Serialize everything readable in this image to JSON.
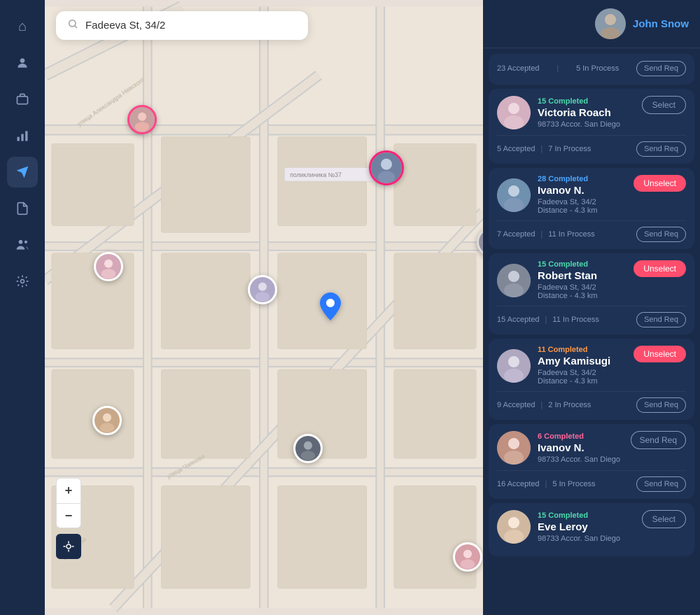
{
  "sidebar": {
    "items": [
      {
        "id": "home",
        "icon": "⌂",
        "label": "Home",
        "active": false
      },
      {
        "id": "person",
        "icon": "👤",
        "label": "Profile",
        "active": false
      },
      {
        "id": "briefcase",
        "icon": "💼",
        "label": "Work",
        "active": false
      },
      {
        "id": "chart",
        "icon": "📊",
        "label": "Analytics",
        "active": false
      },
      {
        "id": "send",
        "icon": "✈",
        "label": "Send",
        "active": true
      },
      {
        "id": "doc",
        "icon": "📄",
        "label": "Documents",
        "active": false
      },
      {
        "id": "group",
        "icon": "👥",
        "label": "Group",
        "active": false
      },
      {
        "id": "settings",
        "icon": "⚙",
        "label": "Settings",
        "active": false
      }
    ]
  },
  "header": {
    "user_name": "John Snow",
    "avatar_alt": "John Snow avatar"
  },
  "search": {
    "placeholder": "Fadeeva St, 34/2",
    "value": "Fadeeva St, 34/2"
  },
  "cards": [
    {
      "id": "card-victoria",
      "completed_count": "15",
      "completed_label": "15 Completed",
      "completed_color": "#4dd9ac",
      "name": "Victoria Roach",
      "address": "98733 Accor. San Diego",
      "distance": null,
      "accepted": "5 Accepted",
      "in_process": "7 In Process",
      "action": "Select",
      "action_type": "select",
      "send_req": "Send Req"
    },
    {
      "id": "card-ivanov1",
      "completed_count": "28",
      "completed_label": "28 Completed",
      "completed_color": "#4da6ff",
      "name": "Ivanov N.",
      "address": "Fadeeva St, 34/2",
      "distance": "Distance - 4.3 km",
      "accepted": "7 Accepted",
      "in_process": "11 In Process",
      "action": "Unselect",
      "action_type": "unselect",
      "send_req": "Send Req"
    },
    {
      "id": "card-robert",
      "completed_count": "15",
      "completed_label": "15 Completed",
      "completed_color": "#4dd9ac",
      "name": "Robert Stan",
      "address": "Fadeeva St, 34/2",
      "distance": "Distance - 4.3 km",
      "accepted": "15 Accepted",
      "in_process": "11 In Process",
      "action": "Unselect",
      "action_type": "unselect",
      "send_req": "Send Req"
    },
    {
      "id": "card-amy",
      "completed_count": "11",
      "completed_label": "11 Completed",
      "completed_color": "#ff9944",
      "name": "Amy Kamisugi",
      "address": "Fadeeva St, 34/2",
      "distance": "Distance - 4.3 km",
      "accepted": "9 Accepted",
      "in_process": "2 In Process",
      "action": "Unselect",
      "action_type": "unselect",
      "send_req": "Send Req"
    },
    {
      "id": "card-ivanov2",
      "completed_count": "6",
      "completed_label": "6 Completed",
      "completed_color": "#ff6699",
      "name": "Ivanov N.",
      "address": "98733 Accor. San Diego",
      "distance": null,
      "accepted": "16 Accepted",
      "in_process": "5 In Process",
      "action": "Send Req",
      "action_type": "send",
      "send_req": "Send Req"
    },
    {
      "id": "card-eve",
      "completed_count": "15",
      "completed_label": "15 Completed",
      "completed_color": "#4dd9ac",
      "name": "Eve Leroy",
      "address": "98733 Accor. San Diego",
      "distance": null,
      "accepted": null,
      "in_process": null,
      "action": "Select",
      "action_type": "select",
      "send_req": null
    }
  ],
  "map": {
    "location_pin": "📍",
    "zoom_in": "+",
    "zoom_out": "−",
    "locate": "⊕"
  }
}
